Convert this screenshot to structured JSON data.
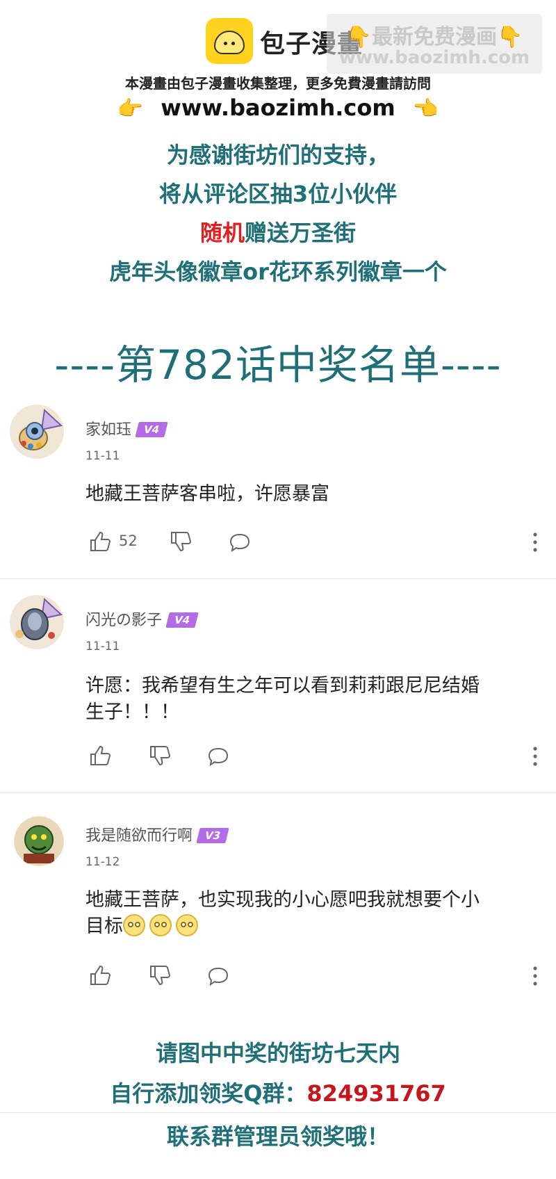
{
  "header": {
    "logo_text": "包子漫畫",
    "watermark_line1": "👇最新免费漫画👇",
    "watermark_line2": "www.baozimh.com",
    "notice": "本漫畫由包子漫畫收集整理，更多免費漫畫請訪問",
    "url": "www.baozimh.com",
    "hand_left": "👉",
    "hand_right": "👈"
  },
  "promo": {
    "line1": "为感谢街坊们的支持，",
    "line2": "将从评论区抽3位小伙伴",
    "line3_red": "随机",
    "line3_rest": "赠送万圣街",
    "line4": "虎年头像徽章or花环系列徽章一个",
    "winners_title": "----第782话中奖名单----"
  },
  "comments": [
    {
      "username": "家如珏",
      "badge": "V4",
      "date": "11-11",
      "text": "地藏王菩萨客串啦，许愿暴富",
      "likes": "52",
      "avatar_icon": "avatar-icon"
    },
    {
      "username": "闪光の影子",
      "badge": "V4",
      "date": "11-11",
      "text_line1": "许愿：我希望有生之年可以看到莉莉跟尼尼结婚",
      "text_line2": "生子！！！",
      "avatar_icon": "avatar-icon"
    },
    {
      "username": "我是随欲而行啊",
      "badge": "V3",
      "date": "11-12",
      "text_line1": "地藏王菩萨，也实现我的小心愿吧我就想要个小",
      "text_line2": "目标",
      "avatar_icon": "avatar-icon"
    }
  ],
  "footer": {
    "line1": "请图中中奖的街坊七天内",
    "line2_prefix": "自行添加领奖Q群：",
    "line2_number": "824931767",
    "line3": "联系群管理员领奖哦！"
  },
  "colors": {
    "teal": "#1F6F78",
    "red": "#E02020",
    "badge_purple": "#B36BE8",
    "logo_yellow": "#FFD21E"
  }
}
